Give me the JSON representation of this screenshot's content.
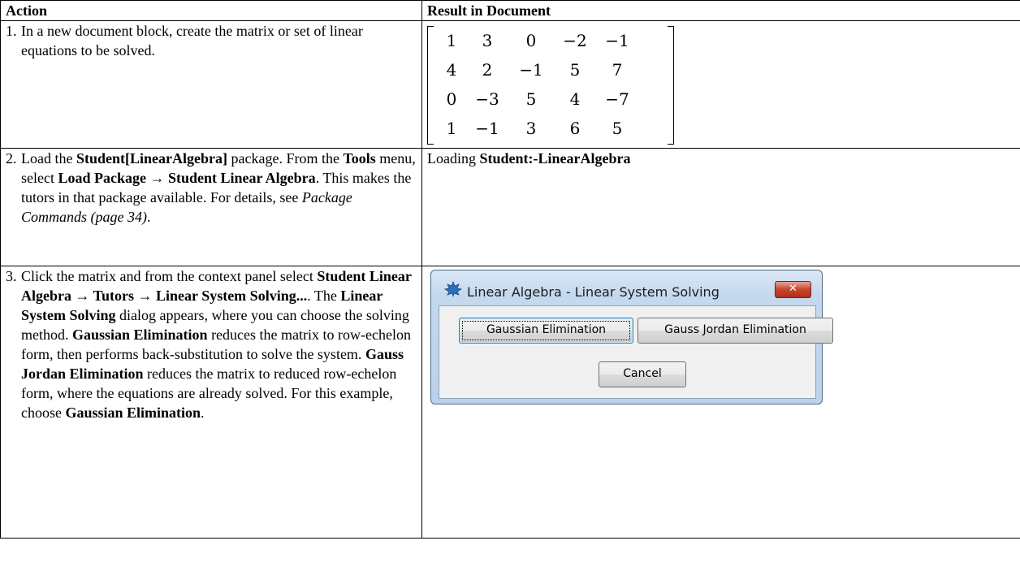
{
  "header": {
    "col1": "Action",
    "col2": "Result in Document"
  },
  "steps": [
    {
      "num": "1.",
      "parts": [
        {
          "t": "In a new document block, create the matrix or set of linear equations to be solved.",
          "s": "n"
        }
      ]
    },
    {
      "num": "2.",
      "parts": [
        {
          "t": "Load the ",
          "s": "n"
        },
        {
          "t": "Student[LinearAlgebra]",
          "s": "b"
        },
        {
          "t": " package. From the ",
          "s": "n"
        },
        {
          "t": "Tools",
          "s": "b"
        },
        {
          "t": " menu, select ",
          "s": "n"
        },
        {
          "t": "Load Package → Student Linear Algebra",
          "s": "b"
        },
        {
          "t": ". This makes the tutors in that package available. For details, see ",
          "s": "n"
        },
        {
          "t": "Package Commands (page 34)",
          "s": "i"
        },
        {
          "t": ".",
          "s": "n"
        }
      ]
    },
    {
      "num": "3.",
      "parts": [
        {
          "t": "Click the matrix and from the context panel select ",
          "s": "n"
        },
        {
          "t": "Student Linear Algebra → Tutors → Linear System Solving...",
          "s": "b"
        },
        {
          "t": ". The ",
          "s": "n"
        },
        {
          "t": "Linear System Solving",
          "s": "b"
        },
        {
          "t": " dialog appears, where you can choose the solving method. ",
          "s": "n"
        },
        {
          "t": "Gaussian Elimination",
          "s": "b"
        },
        {
          "t": " reduces the matrix to row-echelon form, then performs back-substitution to solve the system. ",
          "s": "n"
        },
        {
          "t": "Gauss Jordan Elimination",
          "s": "b"
        },
        {
          "t": " reduces the matrix to reduced row-echelon form, where the equations are already solved. For this example, choose ",
          "s": "n"
        },
        {
          "t": "Gaussian Elimination",
          "s": "b"
        },
        {
          "t": ".",
          "s": "n"
        }
      ]
    }
  ],
  "matrix": [
    [
      "1",
      "3",
      "0",
      "−2",
      "−1"
    ],
    [
      "4",
      "2",
      "−1",
      "5",
      "7"
    ],
    [
      "0",
      "−3",
      "5",
      "4",
      "−7"
    ],
    [
      "1",
      "−1",
      "3",
      "6",
      "5"
    ]
  ],
  "result2": {
    "prefix": "Loading ",
    "bold": "Student:-LinearAlgebra"
  },
  "dialog": {
    "title": "Linear Algebra - Linear System Solving",
    "close": "✕",
    "buttons": {
      "gaussian": "Gaussian Elimination",
      "gauss_jordan": "Gauss Jordan Elimination",
      "cancel": "Cancel"
    }
  }
}
